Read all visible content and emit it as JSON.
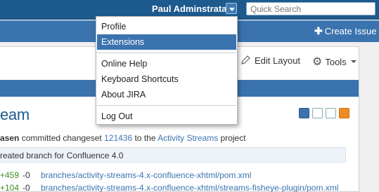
{
  "header": {
    "user_name": "Paul Adminstrata",
    "search_placeholder": "Quick Search",
    "create_issue": "Create Issue"
  },
  "toolbar": {
    "edit_layout": "Edit Layout",
    "tools": "Tools"
  },
  "user_menu": {
    "items": [
      {
        "label": "Profile"
      },
      {
        "label": "Extensions",
        "highlighted": true
      },
      {
        "label": "Online Help"
      },
      {
        "label": "Keyboard Shortcuts"
      },
      {
        "label": "About JIRA"
      },
      {
        "label": "Log Out"
      }
    ]
  },
  "gadget": {
    "title": "eam",
    "activity": {
      "actor": "asen",
      "verb": " committed changeset ",
      "changeset": "121436",
      "to": " to the ",
      "project": "Activity Streams",
      "suffix": " project"
    },
    "commit_message": "reated branch for Confluence 4.0",
    "files": [
      {
        "added": "+459",
        "removed": "-0",
        "path": "branches/activity-streams-4.x-confluence-xhtml/pom.xml"
      },
      {
        "added": "+104",
        "removed": "-0",
        "path": "branches/activity-streams-4.x-confluence-xhtml/streams-fisheye-plugin/pom.xml"
      }
    ]
  },
  "icons": {
    "user_caret": "chevron-down-icon",
    "create": "plus-icon",
    "edit": "pencil-icon",
    "tools": "gear-icon",
    "view_list": "list-view-icon",
    "view_detail": "detail-view-icon",
    "filter": "filter-icon",
    "rss": "rss-icon"
  },
  "colors": {
    "header": "#1d5a8e",
    "accent": "#3b73af",
    "link": "#3b73af",
    "added": "#3d8f1e",
    "rss": "#f08a24"
  }
}
